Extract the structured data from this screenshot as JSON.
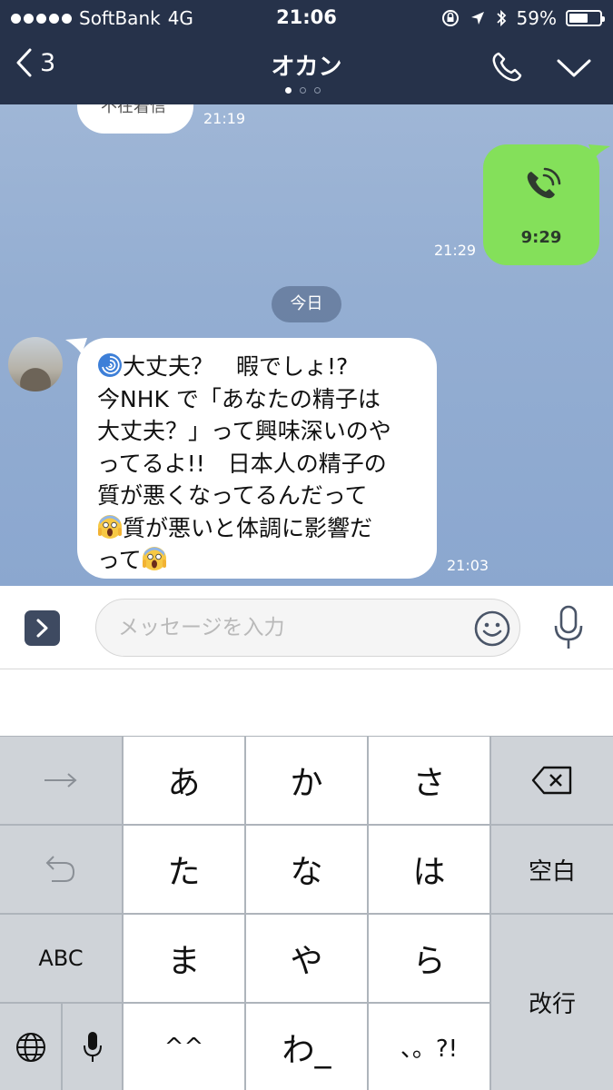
{
  "status_bar": {
    "carrier": "SoftBank",
    "network": "4G",
    "time": "21:06",
    "battery": "59%"
  },
  "nav": {
    "back_count": "3",
    "title": "オカン"
  },
  "chat": {
    "missed_call": {
      "label": "不在着信",
      "time": "21:19"
    },
    "outgoing_call": {
      "duration": "9:29",
      "time": "21:29"
    },
    "date_divider": "今日",
    "message": {
      "line1": "大丈夫？　暇でしょ!?",
      "line2": "今NHK で「あなたの精子は",
      "line3": "大丈夫？」って興味深いのや",
      "line4": "ってるよ!!　日本人の精子の",
      "line5": "質が悪くなってるんだって",
      "line6": "質が悪いと体調に影響だ",
      "line7a": "って",
      "time": "21:03",
      "emoji_icons": [
        "cyclone-icon",
        "screaming-face-icon"
      ]
    }
  },
  "input": {
    "placeholder": "メッセージを入力"
  },
  "keyboard": {
    "row1": [
      "あ",
      "か",
      "さ"
    ],
    "row2": [
      "た",
      "な",
      "は"
    ],
    "row3": [
      "ま",
      "や",
      "ら"
    ],
    "row4": [
      "^^",
      "わ_",
      "、。?!"
    ],
    "abc": "ABC",
    "space": "空白",
    "return": "改行"
  },
  "colors": {
    "header": "#26324a",
    "green_bubble": "#84e05a",
    "chat_bg": "#94aed2"
  }
}
